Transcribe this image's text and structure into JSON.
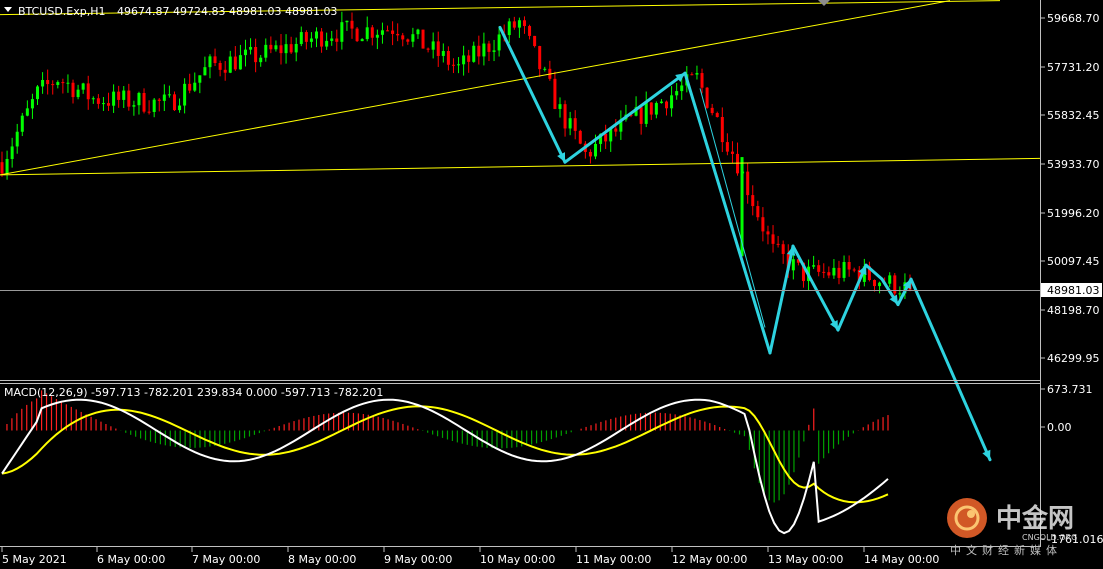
{
  "header": {
    "symbol_info": "BTCUSD.Exp,H1",
    "ohlc": "49674.87 49724.83 48981.03 48981.03"
  },
  "price_axis": {
    "ticks": [
      "59668.70",
      "57731.20",
      "55832.45",
      "53933.70",
      "51996.20",
      "50097.45",
      "48198.70",
      "46299.95"
    ],
    "current_price": "48981.03"
  },
  "macd": {
    "label": "MACD(12,26,9) -597.713 -782.201 239.834 0.000 -597.713 -782.201",
    "ticks": [
      "673.731",
      "0.00",
      "-1761.016"
    ]
  },
  "time_axis": {
    "labels": [
      "5 May 2021",
      "6 May 00:00",
      "7 May 00:00",
      "8 May 00:00",
      "9 May 00:00",
      "10 May 00:00",
      "11 May 00:00",
      "12 May 00:00",
      "13 May 00:00",
      "14 May 00:00"
    ]
  },
  "watermark": {
    "brand": "中金网",
    "url": "CNGOLD.ORG",
    "tagline": "中文财经新媒体"
  },
  "colors": {
    "background": "#000000",
    "bull": "#00ff00",
    "bear": "#ff0000",
    "trendline": "#ffff00",
    "arrow": "#2ed3e0",
    "macd_main": "#ffffff",
    "macd_signal": "#ffff00",
    "hist_pos": "#ff2020",
    "hist_neg": "#00a000"
  },
  "chart_data": {
    "type": "candlestick",
    "title": "BTCUSD.Exp,H1",
    "timeframe": "H1",
    "ylim": [
      45800,
      60400
    ],
    "anchors": [
      {
        "date": "5 May",
        "price": 54000
      },
      {
        "date": "5 May",
        "price": 56700
      },
      {
        "date": "6 May",
        "price": 57300
      },
      {
        "date": "6 May",
        "price": 56500
      },
      {
        "date": "7 May",
        "price": 56300
      },
      {
        "date": "7 May",
        "price": 57800
      },
      {
        "date": "8 May",
        "price": 58200
      },
      {
        "date": "8 May",
        "price": 59100
      },
      {
        "date": "9 May",
        "price": 59300
      },
      {
        "date": "9 May",
        "price": 57700
      },
      {
        "date": "10 May",
        "price": 59500
      },
      {
        "date": "10 May",
        "price": 56000
      },
      {
        "date": "11 May",
        "price": 54300
      },
      {
        "date": "11 May",
        "price": 55500
      },
      {
        "date": "12 May",
        "price": 57300
      },
      {
        "date": "12 May",
        "price": 54000
      },
      {
        "date": "13 May",
        "price": 50500
      },
      {
        "date": "13 May",
        "price": 49600
      },
      {
        "date": "14 May",
        "price": 49700
      },
      {
        "date": "14 May",
        "price": 48981.03
      }
    ],
    "macd_range": [
      -1761.016,
      673.731
    ]
  }
}
